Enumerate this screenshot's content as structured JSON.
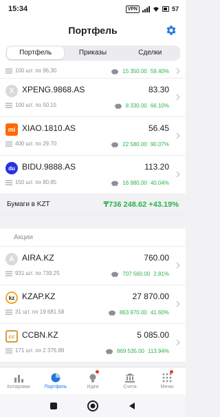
{
  "status": {
    "time": "15:34",
    "vpn": "VPN",
    "battery": "57"
  },
  "header": {
    "title": "Портфель"
  },
  "tabs": [
    "Портфель",
    "Приказы",
    "Сделки"
  ],
  "partial_row": {
    "sub": "100 шт. по 96,30",
    "amount": "15 350.00",
    "percent": "59.40%"
  },
  "holdings_hk": [
    {
      "logo": "X",
      "ticker": "XPENG.9868.AS",
      "price": "83.30",
      "sub": "100 шт. по 50.15",
      "amount": "8 330.00",
      "percent": "66.10%"
    },
    {
      "logo": "mi",
      "ticker": "XIAO.1810.AS",
      "price": "56.45",
      "sub": "400 шт. по 29.70",
      "amount": "22 580.00",
      "percent": "90.07%"
    },
    {
      "logo": "du",
      "ticker": "BIDU.9888.AS",
      "price": "113.20",
      "sub": "150 шт. по 80.85",
      "amount": "16 980.00",
      "percent": "40.04%"
    }
  ],
  "kzt_total": {
    "label": "Бумаги в KZT",
    "amount": "₸736 248.62",
    "percent": "+43.19%"
  },
  "stocks_section": {
    "label": "Акции"
  },
  "holdings_kz": [
    {
      "logo": "A",
      "ticker": "AIRA.KZ",
      "price": "760.00",
      "sub": "931 шт. по 739.25",
      "amount": "707 560.00",
      "percent": "2.81%"
    },
    {
      "logo": "kz",
      "ticker": "KZAP.KZ",
      "price": "27 870.00",
      "sub": "31 шт. по 19 681.58",
      "amount": "863 970.00",
      "percent": "41.60%"
    },
    {
      "logo": "cc",
      "ticker": "CCBN.KZ",
      "price": "5 085.00",
      "sub": "171 шт. по 2 376.88",
      "amount": "869 535.00",
      "percent": "113.94%"
    }
  ],
  "nav": [
    {
      "label": "Котировки",
      "icon": "bar-chart-icon"
    },
    {
      "label": "Портфель",
      "icon": "pie-chart-icon"
    },
    {
      "label": "Идеи",
      "icon": "lightbulb-icon"
    },
    {
      "label": "Счета",
      "icon": "bank-icon"
    },
    {
      "label": "Меню",
      "icon": "grid-menu-icon"
    }
  ],
  "colors": {
    "positive": "#2bb24c",
    "accent": "#2277dd",
    "badge": "#e53935"
  }
}
